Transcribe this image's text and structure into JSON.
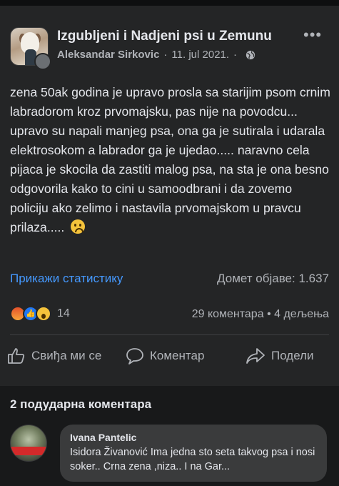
{
  "post": {
    "group_name": "Izgubljeni i Nadjeni psi u Zemunu",
    "author": "Aleksandar Sirkovic",
    "separator": "·",
    "date": "11. jul 2021.",
    "text": "zena 50ak godina je upravo prosla sa starijim psom crnim labradorom kroz prvomajsku, pas nije na povodcu... upravo su napali manjeg psa, ona ga je sutirala i udarala elektrosokom a labrador ga je ujedao..... naravno cela pijaca je skocila da zastiti malog psa, na sta je ona besno odgovorila kako to cini u samoodbrani i da zovemo policiju ako zelimo i nastavila prvomajskom u pravcu prilaza.....",
    "icons": {
      "privacy": "globe-icon",
      "more": "more-options-icon",
      "emoji": "sad-face-emoji"
    }
  },
  "insights": {
    "stats_link": "Прикажи статистику",
    "reach_label": "Домет објаве: 1.637"
  },
  "engagement": {
    "reaction_icons": [
      "angry-reaction-icon",
      "like-reaction-icon",
      "wow-reaction-icon"
    ],
    "reaction_count": "14",
    "comment_count": "29 коментара",
    "separator": "•",
    "share_count": "4 дељења"
  },
  "actions": {
    "like": "Свиђа ми се",
    "comment": "Коментар",
    "share": "Подели"
  },
  "comments": {
    "title": "2 подударна коментара",
    "items": [
      {
        "name": "Ivana Pantelic",
        "text": "Isidora Živanović Ima jedna sto seta takvog psa i nosi soker.. Crna zena ,niza.. I na Gar..."
      }
    ]
  },
  "colors": {
    "background": "#18191a",
    "card": "#242526",
    "link": "#4599ff",
    "secondary_text": "#b0b3b8"
  }
}
